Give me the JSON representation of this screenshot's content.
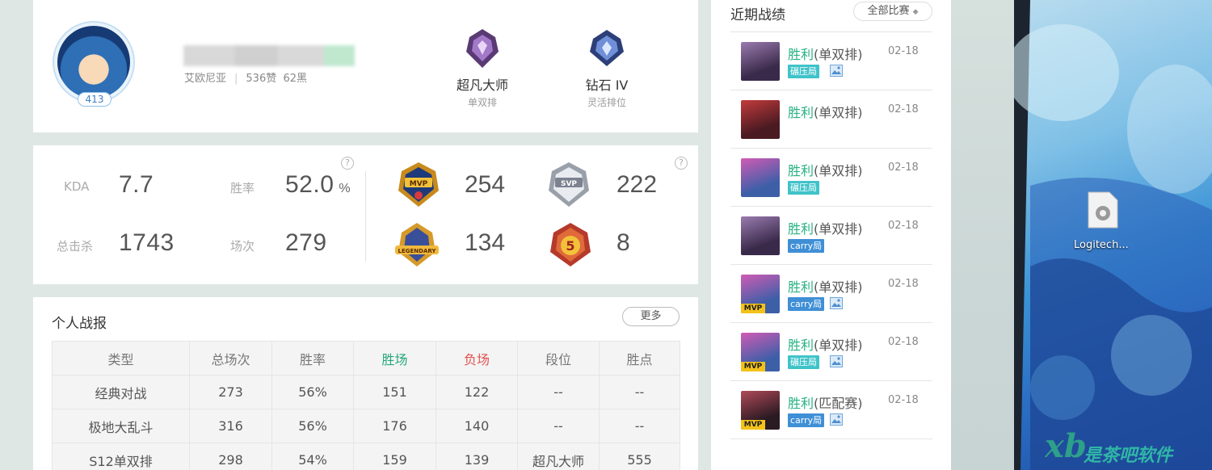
{
  "profile": {
    "level": "413",
    "server": "艾欧尼亚",
    "likes": "536赞",
    "blacks": "62黑",
    "ranks": [
      {
        "name": "超凡大师",
        "queue": "单双排",
        "icon": "master-emblem-icon"
      },
      {
        "name": "钻石 IV",
        "queue": "灵活排位",
        "icon": "diamond-emblem-icon"
      }
    ]
  },
  "stats": {
    "kda_label": "KDA",
    "kda": "7.7",
    "winrate_label": "胜率",
    "winrate": "52.0",
    "winrate_unit": "%",
    "kills_label": "总击杀",
    "kills": "1743",
    "games_label": "场次",
    "games": "279",
    "help": "?",
    "badges": [
      {
        "icon": "mvp-badge-icon",
        "count": "254"
      },
      {
        "icon": "svp-badge-icon",
        "count": "222"
      },
      {
        "icon": "legendary-badge-icon",
        "count": "134"
      },
      {
        "icon": "pentakill-badge-icon",
        "count": "8"
      }
    ]
  },
  "report": {
    "title": "个人战报",
    "more": "更多",
    "headers": [
      "类型",
      "总场次",
      "胜率",
      "胜场",
      "负场",
      "段位",
      "胜点"
    ],
    "rows": [
      [
        "经典对战",
        "273",
        "56%",
        "151",
        "122",
        "--",
        "--"
      ],
      [
        "极地大乱斗",
        "316",
        "56%",
        "176",
        "140",
        "--",
        "--"
      ],
      [
        "S12单双排",
        "298",
        "54%",
        "159",
        "139",
        "超凡大师",
        "555"
      ]
    ]
  },
  "recent": {
    "title": "近期战绩",
    "filter": "全部比赛",
    "matches": [
      {
        "result": "胜利",
        "mode": "(单双排)",
        "date": "02-18",
        "tag": "碾压局",
        "tag_type": "suppress",
        "mvp": false,
        "pic": true,
        "colors": [
          "#3a2a4a",
          "#9a7bb0"
        ]
      },
      {
        "result": "胜利",
        "mode": "(单双排)",
        "date": "02-18",
        "tag": "",
        "tag_type": "",
        "mvp": false,
        "pic": false,
        "colors": [
          "#4a1a22",
          "#c23b3b"
        ]
      },
      {
        "result": "胜利",
        "mode": "(单双排)",
        "date": "02-18",
        "tag": "碾压局",
        "tag_type": "suppress",
        "mvp": false,
        "pic": false,
        "colors": [
          "#3d5fa8",
          "#d05bb4"
        ]
      },
      {
        "result": "胜利",
        "mode": "(单双排)",
        "date": "02-18",
        "tag": "carry局",
        "tag_type": "carry",
        "mvp": false,
        "pic": false,
        "colors": [
          "#3a2a4a",
          "#9a7bb0"
        ]
      },
      {
        "result": "胜利",
        "mode": "(单双排)",
        "date": "02-18",
        "tag": "carry局",
        "tag_type": "carry",
        "mvp": true,
        "pic": true,
        "colors": [
          "#3d5fa8",
          "#d05bb4"
        ]
      },
      {
        "result": "胜利",
        "mode": "(单双排)",
        "date": "02-18",
        "tag": "碾压局",
        "tag_type": "suppress",
        "mvp": true,
        "pic": true,
        "colors": [
          "#3d5fa8",
          "#d05bb4"
        ]
      },
      {
        "result": "胜利",
        "mode": "(匹配赛)",
        "date": "02-18",
        "tag": "carry局",
        "tag_type": "carry",
        "mvp": true,
        "pic": true,
        "colors": [
          "#2a1a22",
          "#b04a58"
        ]
      }
    ],
    "mvp_label": "MVP"
  },
  "desktop": {
    "icon_label": "Logitech...",
    "watermark": "是茶吧软件"
  }
}
